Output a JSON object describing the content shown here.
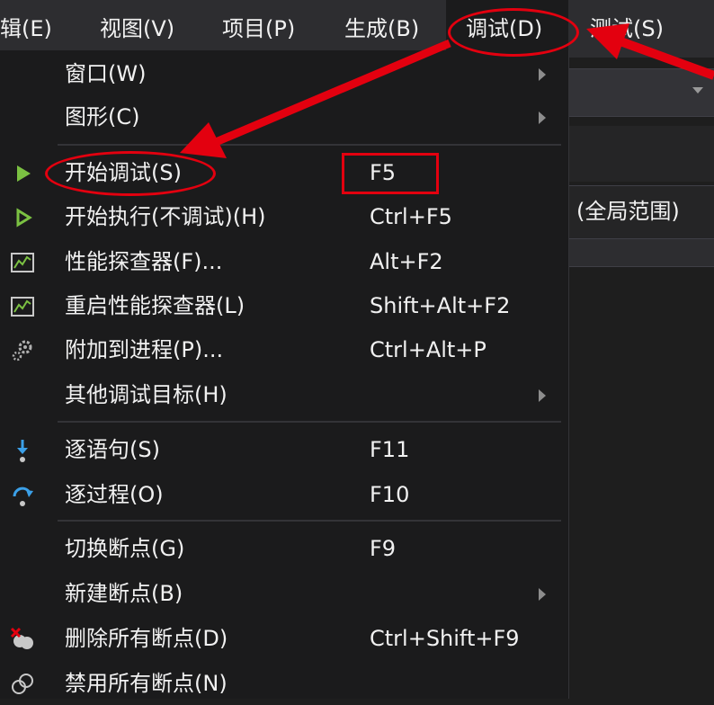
{
  "menubar": {
    "items": [
      {
        "label": "辑(E)"
      },
      {
        "label": "视图(V)"
      },
      {
        "label": "项目(P)"
      },
      {
        "label": "生成(B)"
      },
      {
        "label": "调试(D)"
      },
      {
        "label": "测试(S)"
      }
    ]
  },
  "scope": {
    "label": "(全局范围)"
  },
  "debug_menu": {
    "items": [
      {
        "label": "窗口(W)",
        "shortcut": "",
        "icon": "none",
        "submenu": true
      },
      {
        "label": "图形(C)",
        "shortcut": "",
        "icon": "none",
        "submenu": true
      },
      {
        "label": "开始调试(S)",
        "shortcut": "F5",
        "icon": "play-filled-icon",
        "submenu": false
      },
      {
        "label": "开始执行(不调试)(H)",
        "shortcut": "Ctrl+F5",
        "icon": "play-outline-icon",
        "submenu": false
      },
      {
        "label": "性能探查器(F)...",
        "shortcut": "Alt+F2",
        "icon": "performance-chart-icon",
        "submenu": false
      },
      {
        "label": "重启性能探查器(L)",
        "shortcut": "Shift+Alt+F2",
        "icon": "performance-chart-icon",
        "submenu": false
      },
      {
        "label": "附加到进程(P)...",
        "shortcut": "Ctrl+Alt+P",
        "icon": "gears-icon",
        "submenu": false
      },
      {
        "label": "其他调试目标(H)",
        "shortcut": "",
        "icon": "none",
        "submenu": true
      },
      {
        "label": "逐语句(S)",
        "shortcut": "F11",
        "icon": "step-into-icon",
        "submenu": false
      },
      {
        "label": "逐过程(O)",
        "shortcut": "F10",
        "icon": "step-over-icon",
        "submenu": false
      },
      {
        "label": "切换断点(G)",
        "shortcut": "F9",
        "icon": "none",
        "submenu": false
      },
      {
        "label": "新建断点(B)",
        "shortcut": "",
        "icon": "none",
        "submenu": true
      },
      {
        "label": "删除所有断点(D)",
        "shortcut": "Ctrl+Shift+F9",
        "icon": "delete-breakpoints-icon",
        "submenu": false
      },
      {
        "label": "禁用所有断点(N)",
        "shortcut": "",
        "icon": "disable-breakpoints-icon",
        "submenu": false
      }
    ]
  },
  "colors": {
    "menubar_bg": "#2d2d30",
    "menu_bg": "#1b1b1c",
    "annotation_red": "#e3000f",
    "play_green": "#7bc142",
    "step_blue": "#3ba0e8"
  }
}
